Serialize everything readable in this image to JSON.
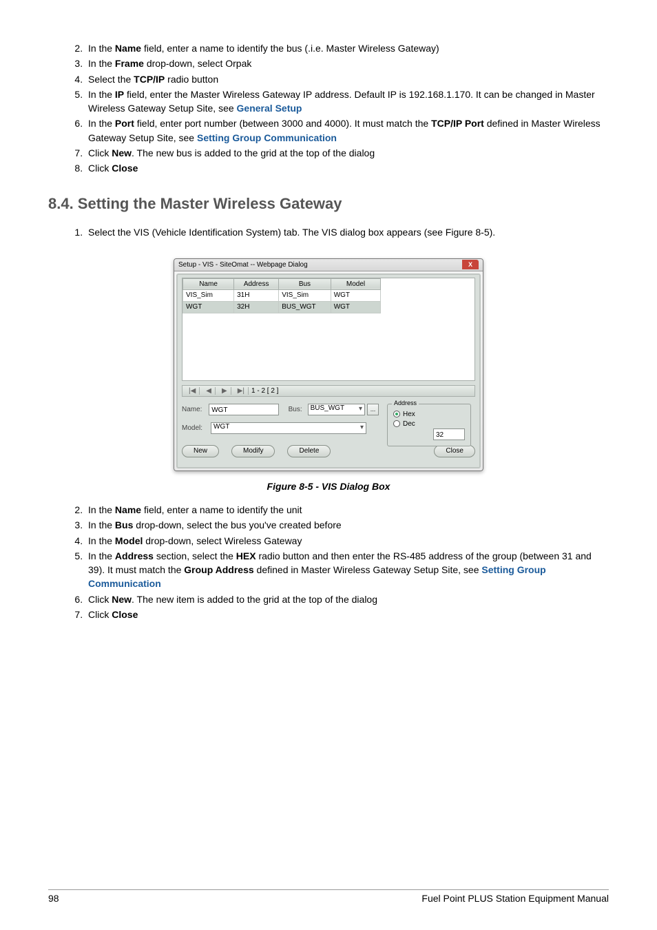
{
  "top_list": [
    {
      "prefix": "In the ",
      "bold1": "Name",
      "mid": " field, enter a name to identify the bus (.i.e. Master Wireless Gateway)"
    },
    {
      "prefix": "In the ",
      "bold1": "Frame",
      "mid": " drop-down, select Orpak"
    },
    {
      "prefix": "Select the ",
      "bold1": "TCP/IP",
      "mid": " radio button"
    },
    {
      "prefix": "In the ",
      "bold1": "IP",
      "mid": " field, enter the Master Wireless Gateway IP address. Default IP is 192.168.1.170. It can be changed in Master Wireless Gateway Setup Site, see ",
      "link": "General Setup"
    },
    {
      "prefix": "In the ",
      "bold1": "Port",
      "mid": " field, enter port number (between 3000 and 4000). It must match the ",
      "bold2": "TCP/IP Port",
      "mid2": " defined in Master Wireless Gateway Setup Site, see ",
      "link": "Setting Group Communication"
    },
    {
      "prefix": "Click ",
      "bold1": "New",
      "mid": ". The new bus is added to the grid at the top of the dialog"
    },
    {
      "prefix": "Click ",
      "bold1": "Close",
      "mid": ""
    }
  ],
  "section_heading": "8.4. Setting the Master Wireless Gateway",
  "mid_list_1": "Select the VIS (Vehicle Identification System) tab. The VIS dialog box appears (see Figure 8-5).",
  "dialog": {
    "title": "Setup - VIS - SiteOmat -- Webpage Dialog",
    "close_x": "X",
    "grid": {
      "headers": [
        "Name",
        "Address",
        "Bus",
        "Model"
      ],
      "rows": [
        [
          "VIS_Sim",
          "31H",
          "VIS_Sim",
          "WGT"
        ],
        [
          "WGT",
          "32H",
          "BUS_WGT",
          "WGT"
        ]
      ]
    },
    "pager": {
      "nav": [
        "|◀",
        "◀",
        "▶",
        "▶|"
      ],
      "label": "1 - 2 [ 2 ]"
    },
    "form": {
      "name_label": "Name:",
      "name_value": "WGT",
      "bus_label": "Bus:",
      "bus_value": "BUS_WGT",
      "bus_more": "...",
      "model_label": "Model:",
      "model_value": "WGT"
    },
    "fieldset": {
      "legend": "Address",
      "hex": "Hex",
      "dec": "Dec",
      "value": "32"
    },
    "buttons": {
      "new": "New",
      "modify": "Modify",
      "delete": "Delete",
      "close": "Close"
    }
  },
  "figure_caption": "Figure 8-5 - VIS Dialog Box",
  "bottom_list": [
    {
      "prefix": "In the ",
      "bold1": "Name",
      "mid": " field, enter a name to identify the unit"
    },
    {
      "prefix": "In the ",
      "bold1": "Bus",
      "mid": " drop-down, select the bus you've created before"
    },
    {
      "prefix": "In the ",
      "bold1": "Model",
      "mid": " drop-down, select Wireless Gateway"
    },
    {
      "prefix": "In the ",
      "bold1": "Address",
      "mid": " section, select the ",
      "bold2": "HEX",
      "mid2": " radio button and then enter the RS-485 address of the group (between 31 and 39). It must match the ",
      "bold3": "Group Address",
      "mid3": " defined in Master Wireless Gateway Setup Site, see ",
      "link": "Setting Group Communication"
    },
    {
      "prefix": "Click ",
      "bold1": "New",
      "mid": ". The new item is added to the grid at the top of the dialog"
    },
    {
      "prefix": "Click ",
      "bold1": "Close",
      "mid": ""
    }
  ],
  "footer": {
    "page": "98",
    "title": "Fuel Point PLUS Station Equipment Manual"
  }
}
